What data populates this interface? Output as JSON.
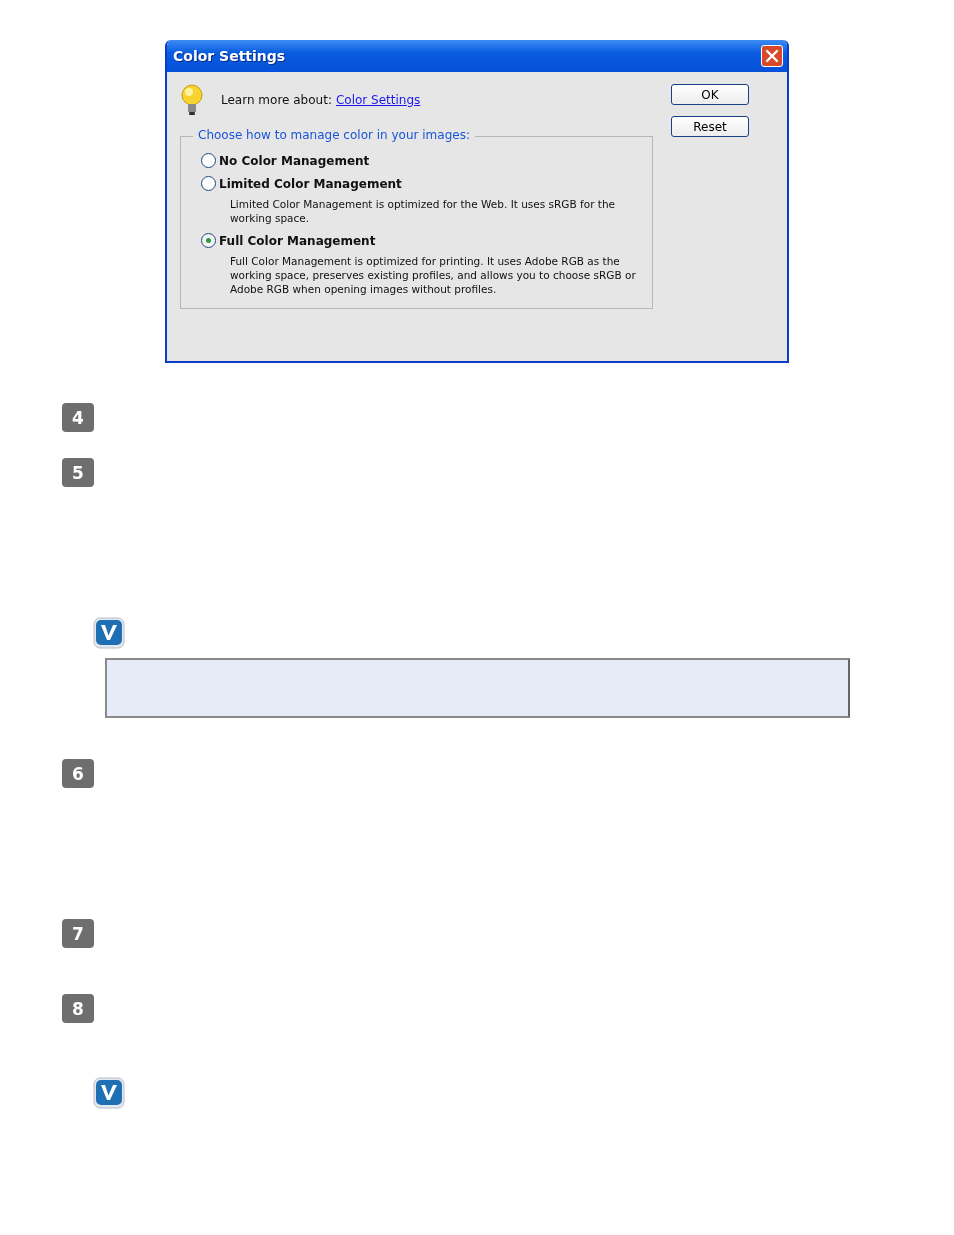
{
  "dialog": {
    "title": "Color Settings",
    "learn_more": {
      "label": "Learn more about:",
      "link": "Color Settings"
    },
    "group_label": "Choose how to manage color in your images:",
    "options": [
      {
        "label": "No Color Management",
        "selected": false
      },
      {
        "label": "Limited Color Management",
        "selected": false,
        "description": "Limited Color Management is optimized for the Web. It uses sRGB for the working space."
      },
      {
        "label": "Full Color Management",
        "selected": true,
        "description": "Full Color Management is optimized for printing. It uses Adobe RGB as the working space, preserves existing profiles, and allows you to choose sRGB or Adobe RGB when opening images without profiles."
      }
    ],
    "buttons": [
      "OK",
      "Reset"
    ]
  },
  "blocks": [
    {
      "kind": "step",
      "number": "4"
    },
    {
      "kind": "step",
      "number": "5"
    },
    {
      "kind": "boxnote"
    },
    {
      "kind": "step",
      "number": "6"
    },
    {
      "kind": "step",
      "number": "7"
    },
    {
      "kind": "step",
      "number": "8"
    },
    {
      "kind": "note"
    }
  ]
}
